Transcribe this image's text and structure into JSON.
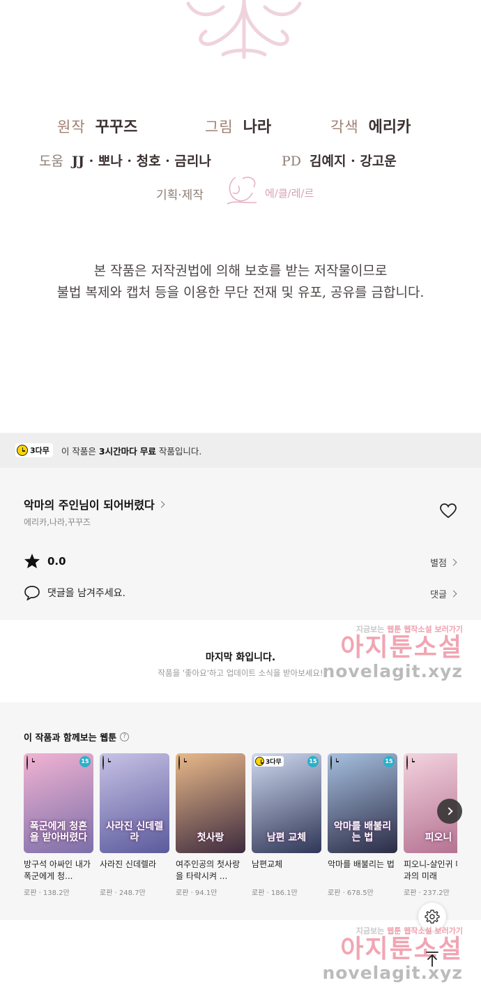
{
  "credits": {
    "original_label": "원작",
    "original_name": "꾸꾸즈",
    "art_label": "그림",
    "art_name": "나라",
    "adapt_label": "각색",
    "adapt_name": "에리카",
    "assist_label": "도움",
    "assist_names": "JJ · 뽀나 · 청호 · 금리나",
    "pd_label": "PD",
    "pd_names": "김예지 · 강고운",
    "produce_label": "기획·제작",
    "studio_name": "에/클/레/르",
    "notice_line1": "본 작품은 저작권법에 의해 보호를 받는 저작물이므로",
    "notice_line2": "불법 복제와 캡처 등을 이용한 무단 전재 및 유포, 공유를 금합니다."
  },
  "free_banner": {
    "badge": "3다무",
    "text_prefix": "이 작품은",
    "text_bold": "3시간마다 무료",
    "text_suffix": "작품입니다."
  },
  "work": {
    "title": "악마의 주인님이 되어버렸다",
    "authors": "에리카,나라,꾸꾸즈",
    "rating": "0.0",
    "rating_link": "별점",
    "comment_prompt": "댓글을 남겨주세요.",
    "comment_link": "댓글"
  },
  "last_episode": {
    "title": "마지막 화입니다.",
    "subtitle": "작품을 '좋아요'하고 업데이트 소식을 받아보세요!"
  },
  "recommend": {
    "heading": "이 작품과 함께보는 웹툰",
    "help": "?",
    "items": [
      {
        "name": "방구석 아싸인 내가 폭군에게 청...",
        "meta": "로판 · 138.2만",
        "thumb_text": "폭군에게 청혼을 받아버렸다",
        "badge": "clock",
        "age": "15",
        "c1": "#f2b3d3",
        "c2": "#7b6fa8"
      },
      {
        "name": "사라진 신데렐라",
        "meta": "로판 · 248.7만",
        "thumb_text": "사라진 신데렐라",
        "badge": "clock",
        "age": "",
        "c1": "#c7c2e6",
        "c2": "#5b5a9c"
      },
      {
        "name": "여주인공의 첫사랑을 타락시켜 ...",
        "meta": "로판 · 94.1만",
        "thumb_text": "첫사랑",
        "badge": "clock",
        "age": "",
        "c1": "#e9b98a",
        "c2": "#3d2b3e"
      },
      {
        "name": "남편교체",
        "meta": "로판 · 186.1만",
        "thumb_text": "남편 교체",
        "badge": "3다무",
        "age": "15",
        "c1": "#cfd9f0",
        "c2": "#2f3657"
      },
      {
        "name": "악마를 배불리는 법",
        "meta": "로판 · 678.5만",
        "thumb_text": "악마를 배불리는 법",
        "badge": "clock",
        "age": "15",
        "c1": "#a7c0e0",
        "c2": "#2b2c45"
      },
      {
        "name": "피오니-살인귀 대공과의 미래",
        "meta": "로판 · 237.2만",
        "thumb_text": "피오니",
        "badge": "clock",
        "age": "",
        "c1": "#f4d3df",
        "c2": "#b16e8e"
      }
    ]
  },
  "watermark": {
    "small_a": "지금보는",
    "small_b": "웹툰",
    "small_c": "웹작소설",
    "small_d": "보러가기",
    "big": "아지툰소설",
    "url": "novelagit.xyz"
  },
  "icons": {
    "heart": "heart-icon",
    "star": "star-icon",
    "comment": "speech-bubble-icon",
    "settings": "gear-icon",
    "top": "arrow-up-icon",
    "next": "chevron-right-icon"
  },
  "colors": {
    "free_badge": "#ffd500",
    "age_badge": "#2bb0c8",
    "watermark_pink": "#eb8296"
  }
}
